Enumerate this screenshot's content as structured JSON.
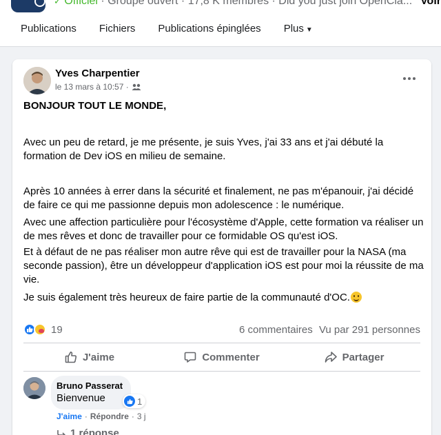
{
  "group": {
    "official_label": "Officiel",
    "meta_text": " · Groupe ouvert · 17,8 K membres · Did you just join OpenCla...",
    "see_more": "Voir",
    "tabs": [
      "Publications",
      "Fichiers",
      "Publications épinglées",
      "Plus"
    ]
  },
  "post": {
    "author": "Yves Charpentier",
    "time": "le 13 mars à 10:57 ·",
    "audience_icon": "group-audience-icon",
    "heading": "BONJOUR TOUT LE MONDE,",
    "paragraphs": [
      "Avec un peu de retard, je me présente, je suis Yves, j'ai 33 ans et j'ai débuté la formation de Dev iOS en milieu de semaine.",
      "Après 10 années à errer dans la sécurité et finalement, ne pas m'épanouir, j'ai décidé de faire ce qui me passionne depuis mon adolescence : le numérique.",
      "Avec une affection particulière pour l'écosystème d'Apple, cette formation va réaliser un de mes rêves et donc de travailler pour ce formidable OS qu'est iOS.",
      "Et à défaut de ne pas réaliser mon autre rêve qui est de travailler pour la NASA (ma seconde passion), être un développeur d'application iOS est pour moi la réussite de ma vie.",
      "Je suis également très heureux de faire partie de la communauté d'OC."
    ],
    "reaction_count": "19",
    "comments_count": "6 commentaires",
    "seen_by": "Vu par 291 personnes",
    "actions": {
      "like": "J'aime",
      "comment": "Commenter",
      "share": "Partager"
    }
  },
  "comment": {
    "author": "Bruno Passerat",
    "text": "Bienvenue",
    "reaction_count": "1",
    "like_label": "J'aime",
    "reply_label": "Répondre",
    "age": "3 j",
    "replies_label": "1 réponse"
  },
  "colors": {
    "accent": "#1877f2",
    "official": "#42b72a",
    "secondary_text": "#65676b"
  }
}
